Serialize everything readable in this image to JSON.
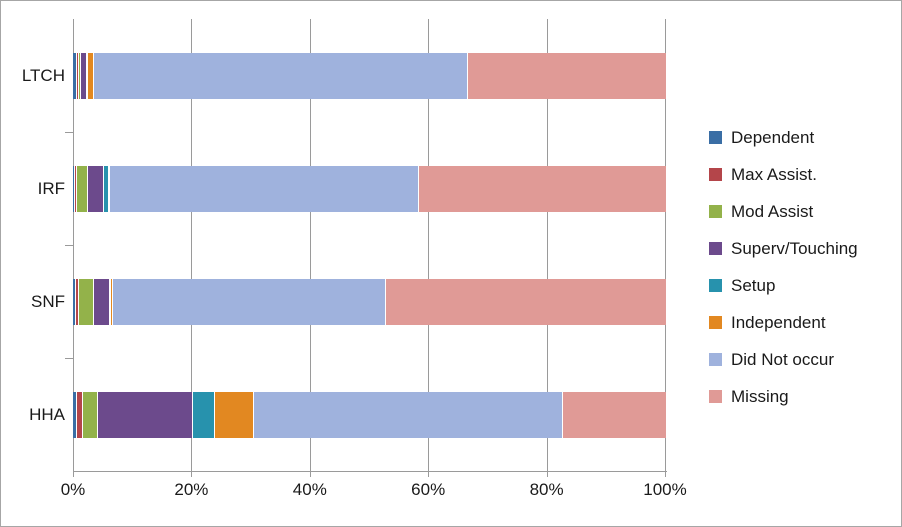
{
  "chart_data": {
    "type": "bar",
    "orientation": "horizontal",
    "stacked": true,
    "stack_mode": "percent",
    "title": "",
    "subtitle": "",
    "xlabel": "",
    "ylabel": "",
    "xlim": [
      0,
      100
    ],
    "xticks": [
      0,
      20,
      40,
      60,
      80,
      100
    ],
    "xtick_labels": [
      "0%",
      "20%",
      "40%",
      "60%",
      "80%",
      "100%"
    ],
    "categories": [
      "LTCH",
      "IRF",
      "SNF",
      "HHA"
    ],
    "grid": true,
    "grid_axis": "x",
    "legend_position": "right",
    "series": [
      {
        "name": "Dependent",
        "color": "#3a6ea5",
        "values": [
          0.7,
          0.3,
          0.5,
          0.7
        ]
      },
      {
        "name": "Max Assist.",
        "color": "#b4454a",
        "values": [
          0.3,
          0.3,
          0.5,
          1.0
        ]
      },
      {
        "name": "Mod Assist",
        "color": "#93b24a",
        "values": [
          0.3,
          2.0,
          2.5,
          2.5
        ]
      },
      {
        "name": "Superv/Touching",
        "color": "#6c4a8c",
        "values": [
          1.0,
          2.7,
          2.7,
          16.0
        ]
      },
      {
        "name": "Setup",
        "color": "#2792ad",
        "values": [
          0.3,
          0.7,
          0.3,
          3.7
        ]
      },
      {
        "name": "Independent",
        "color": "#e28821",
        "values": [
          1.0,
          0.3,
          0.3,
          6.6
        ]
      },
      {
        "name": "Did Not occur",
        "color": "#9fb2dd",
        "values": [
          63.0,
          52.0,
          46.0,
          52.1
        ]
      },
      {
        "name": "Missing",
        "color": "#e09a96",
        "values": [
          33.4,
          41.7,
          47.2,
          17.4
        ]
      }
    ]
  },
  "legend": {
    "items": [
      {
        "label": "Dependent",
        "color": "#3a6ea5"
      },
      {
        "label": "Max Assist.",
        "color": "#b4454a"
      },
      {
        "label": "Mod Assist",
        "color": "#93b24a"
      },
      {
        "label": "Superv/Touching",
        "color": "#6c4a8c"
      },
      {
        "label": "Setup",
        "color": "#2792ad"
      },
      {
        "label": "Independent",
        "color": "#e28821"
      },
      {
        "label": "Did Not occur",
        "color": "#9fb2dd"
      },
      {
        "label": "Missing",
        "color": "#e09a96"
      }
    ]
  }
}
